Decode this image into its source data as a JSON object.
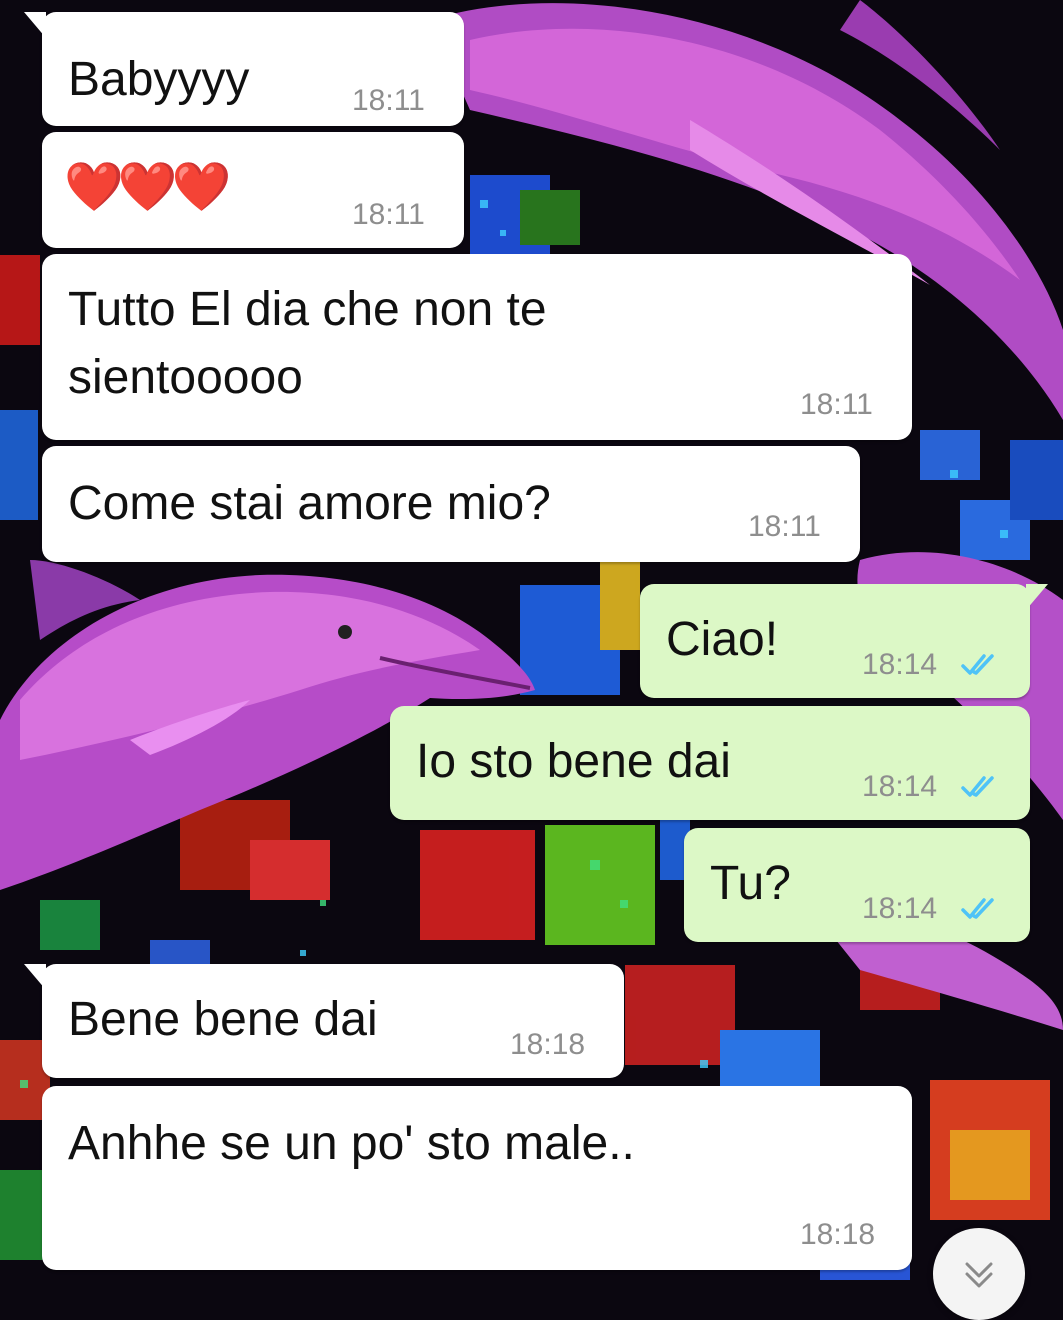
{
  "chat": {
    "messages": [
      {
        "direction": "incoming",
        "text": "Babyyyy",
        "time": "18:11"
      },
      {
        "direction": "incoming",
        "text": "❤️❤️❤️",
        "time": "18:11"
      },
      {
        "direction": "incoming",
        "text": "Tutto El dia che non te sientooooo",
        "time": "18:11"
      },
      {
        "direction": "incoming",
        "text": "Come stai amore mio?",
        "time": "18:11"
      },
      {
        "direction": "outgoing",
        "text": "Ciao!",
        "time": "18:14",
        "status": "read"
      },
      {
        "direction": "outgoing",
        "text": "Io sto bene dai",
        "time": "18:14",
        "status": "read"
      },
      {
        "direction": "outgoing",
        "text": "Tu?",
        "time": "18:14",
        "status": "read"
      },
      {
        "direction": "incoming",
        "text": "Bene bene dai",
        "time": "18:18"
      },
      {
        "direction": "incoming",
        "text": "Anhhe se un po' sto male..",
        "time": "18:18"
      }
    ]
  },
  "icons": {
    "read_receipt": "double-check-icon",
    "scroll_down": "chevron-down-icon"
  },
  "colors": {
    "incoming_bubble": "#ffffff",
    "outgoing_bubble": "#dcf8c6",
    "read_ticks": "#4fc3f7",
    "timestamp": "#8e8e8e",
    "wallpaper_dolphin": "#c045c8"
  }
}
